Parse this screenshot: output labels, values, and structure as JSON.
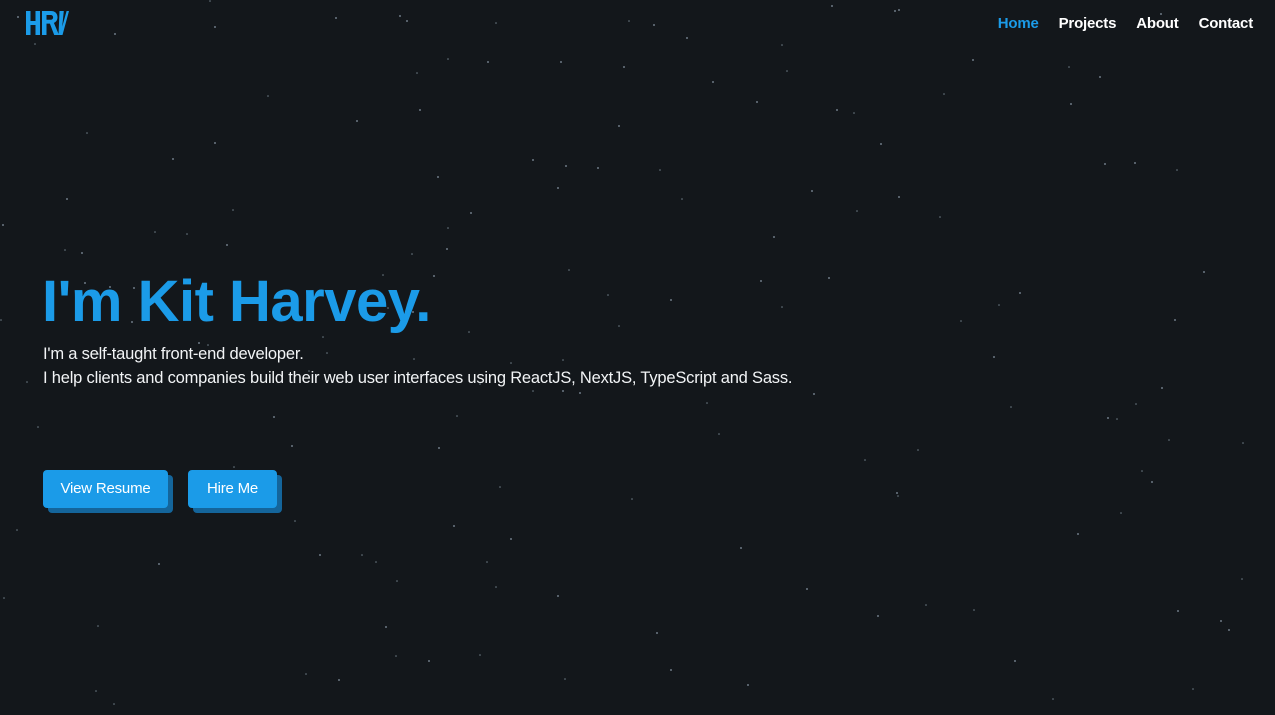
{
  "brand": {
    "logo_text": "HRV",
    "accent_color": "#1b9be8",
    "background_color": "#13171b"
  },
  "nav": {
    "items": [
      {
        "label": "Home",
        "active": true
      },
      {
        "label": "Projects",
        "active": false
      },
      {
        "label": "About",
        "active": false
      },
      {
        "label": "Contact",
        "active": false
      }
    ]
  },
  "hero": {
    "title": "I'm Kit Harvey.",
    "line1": "I'm a self-taught front-end developer.",
    "line2": "I help clients and companies build their web user interfaces using ReactJS, NextJS, TypeScript and Sass.",
    "buttons": {
      "resume_label": "View Resume",
      "hire_label": "Hire Me"
    }
  }
}
